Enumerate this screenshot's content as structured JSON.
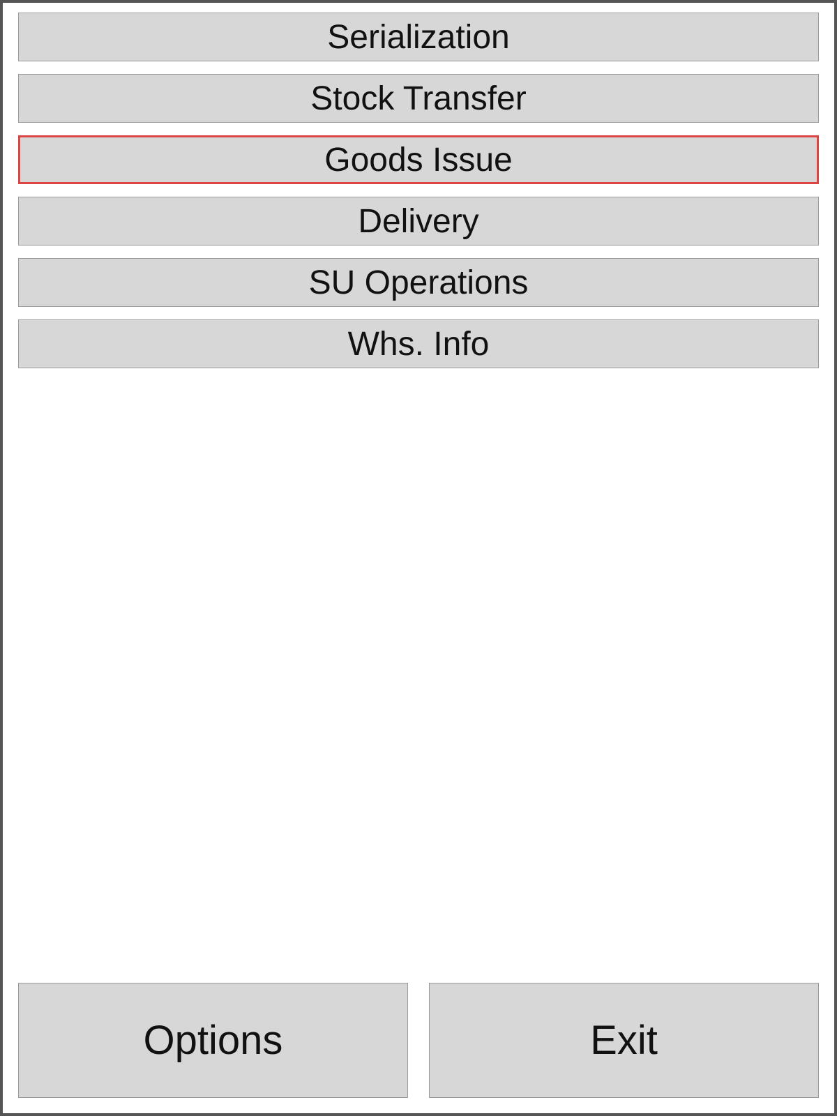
{
  "menu": {
    "items": [
      {
        "label": "Serialization",
        "highlight": false
      },
      {
        "label": "Stock Transfer",
        "highlight": false
      },
      {
        "label": "Goods Issue",
        "highlight": true
      },
      {
        "label": "Delivery",
        "highlight": false
      },
      {
        "label": "SU Operations",
        "highlight": false
      },
      {
        "label": "Whs. Info",
        "highlight": false
      }
    ]
  },
  "footer": {
    "options_label": "Options",
    "exit_label": "Exit"
  },
  "colors": {
    "button_bg": "#d7d7d7",
    "button_border": "#9a9a9a",
    "highlight_border": "#d44",
    "frame_border": "#555"
  }
}
